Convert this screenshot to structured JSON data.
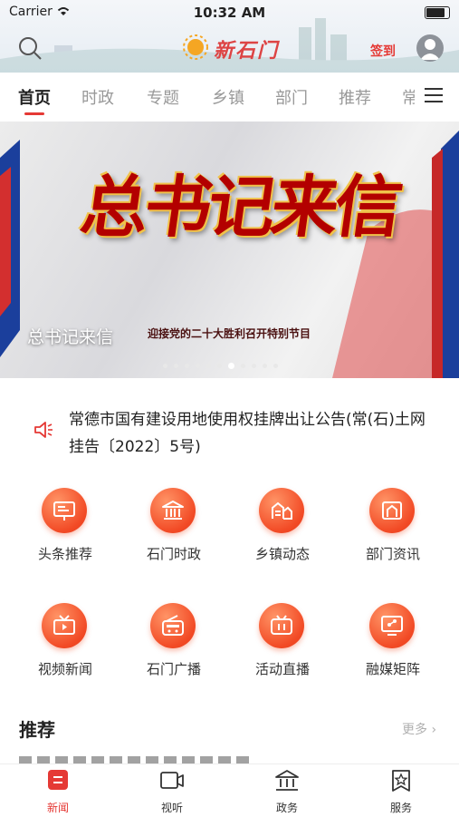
{
  "status_bar": {
    "carrier": "Carrier",
    "time": "10:32 AM"
  },
  "header": {
    "logo_text": "新石门",
    "checkin_label": "签到"
  },
  "tabs": [
    {
      "label": "首页",
      "active": true
    },
    {
      "label": "时政"
    },
    {
      "label": "专题"
    },
    {
      "label": "乡镇"
    },
    {
      "label": "部门"
    },
    {
      "label": "推荐"
    },
    {
      "label": "常"
    }
  ],
  "banner": {
    "art_title": "总书记来信",
    "caption": "总书记来信",
    "subtitle": "迎接党的二十大胜利召开特别节目",
    "slide_count": 11,
    "active_slide": 6
  },
  "notice": {
    "text": "常德市国有建设用地使用权挂牌出让公告(常(石)土网挂告〔2022〕5号)"
  },
  "grid": [
    {
      "label": "头条推荐",
      "icon": "headline-screen-icon"
    },
    {
      "label": "石门时政",
      "icon": "government-building-icon"
    },
    {
      "label": "乡镇动态",
      "icon": "town-icon"
    },
    {
      "label": "部门资讯",
      "icon": "department-house-icon"
    },
    {
      "label": "视频新闻",
      "icon": "tv-icon"
    },
    {
      "label": "石门广播",
      "icon": "radio-icon"
    },
    {
      "label": "活动直播",
      "icon": "live-broadcast-icon"
    },
    {
      "label": "融媒矩阵",
      "icon": "media-matrix-icon"
    }
  ],
  "recommend": {
    "title": "推荐",
    "more": "更多"
  },
  "bottom_nav": [
    {
      "label": "新闻",
      "active": true
    },
    {
      "label": "视听"
    },
    {
      "label": "政务"
    },
    {
      "label": "服务"
    }
  ],
  "colors": {
    "accent": "#e53935",
    "icon_gradient": "#f24a25"
  }
}
